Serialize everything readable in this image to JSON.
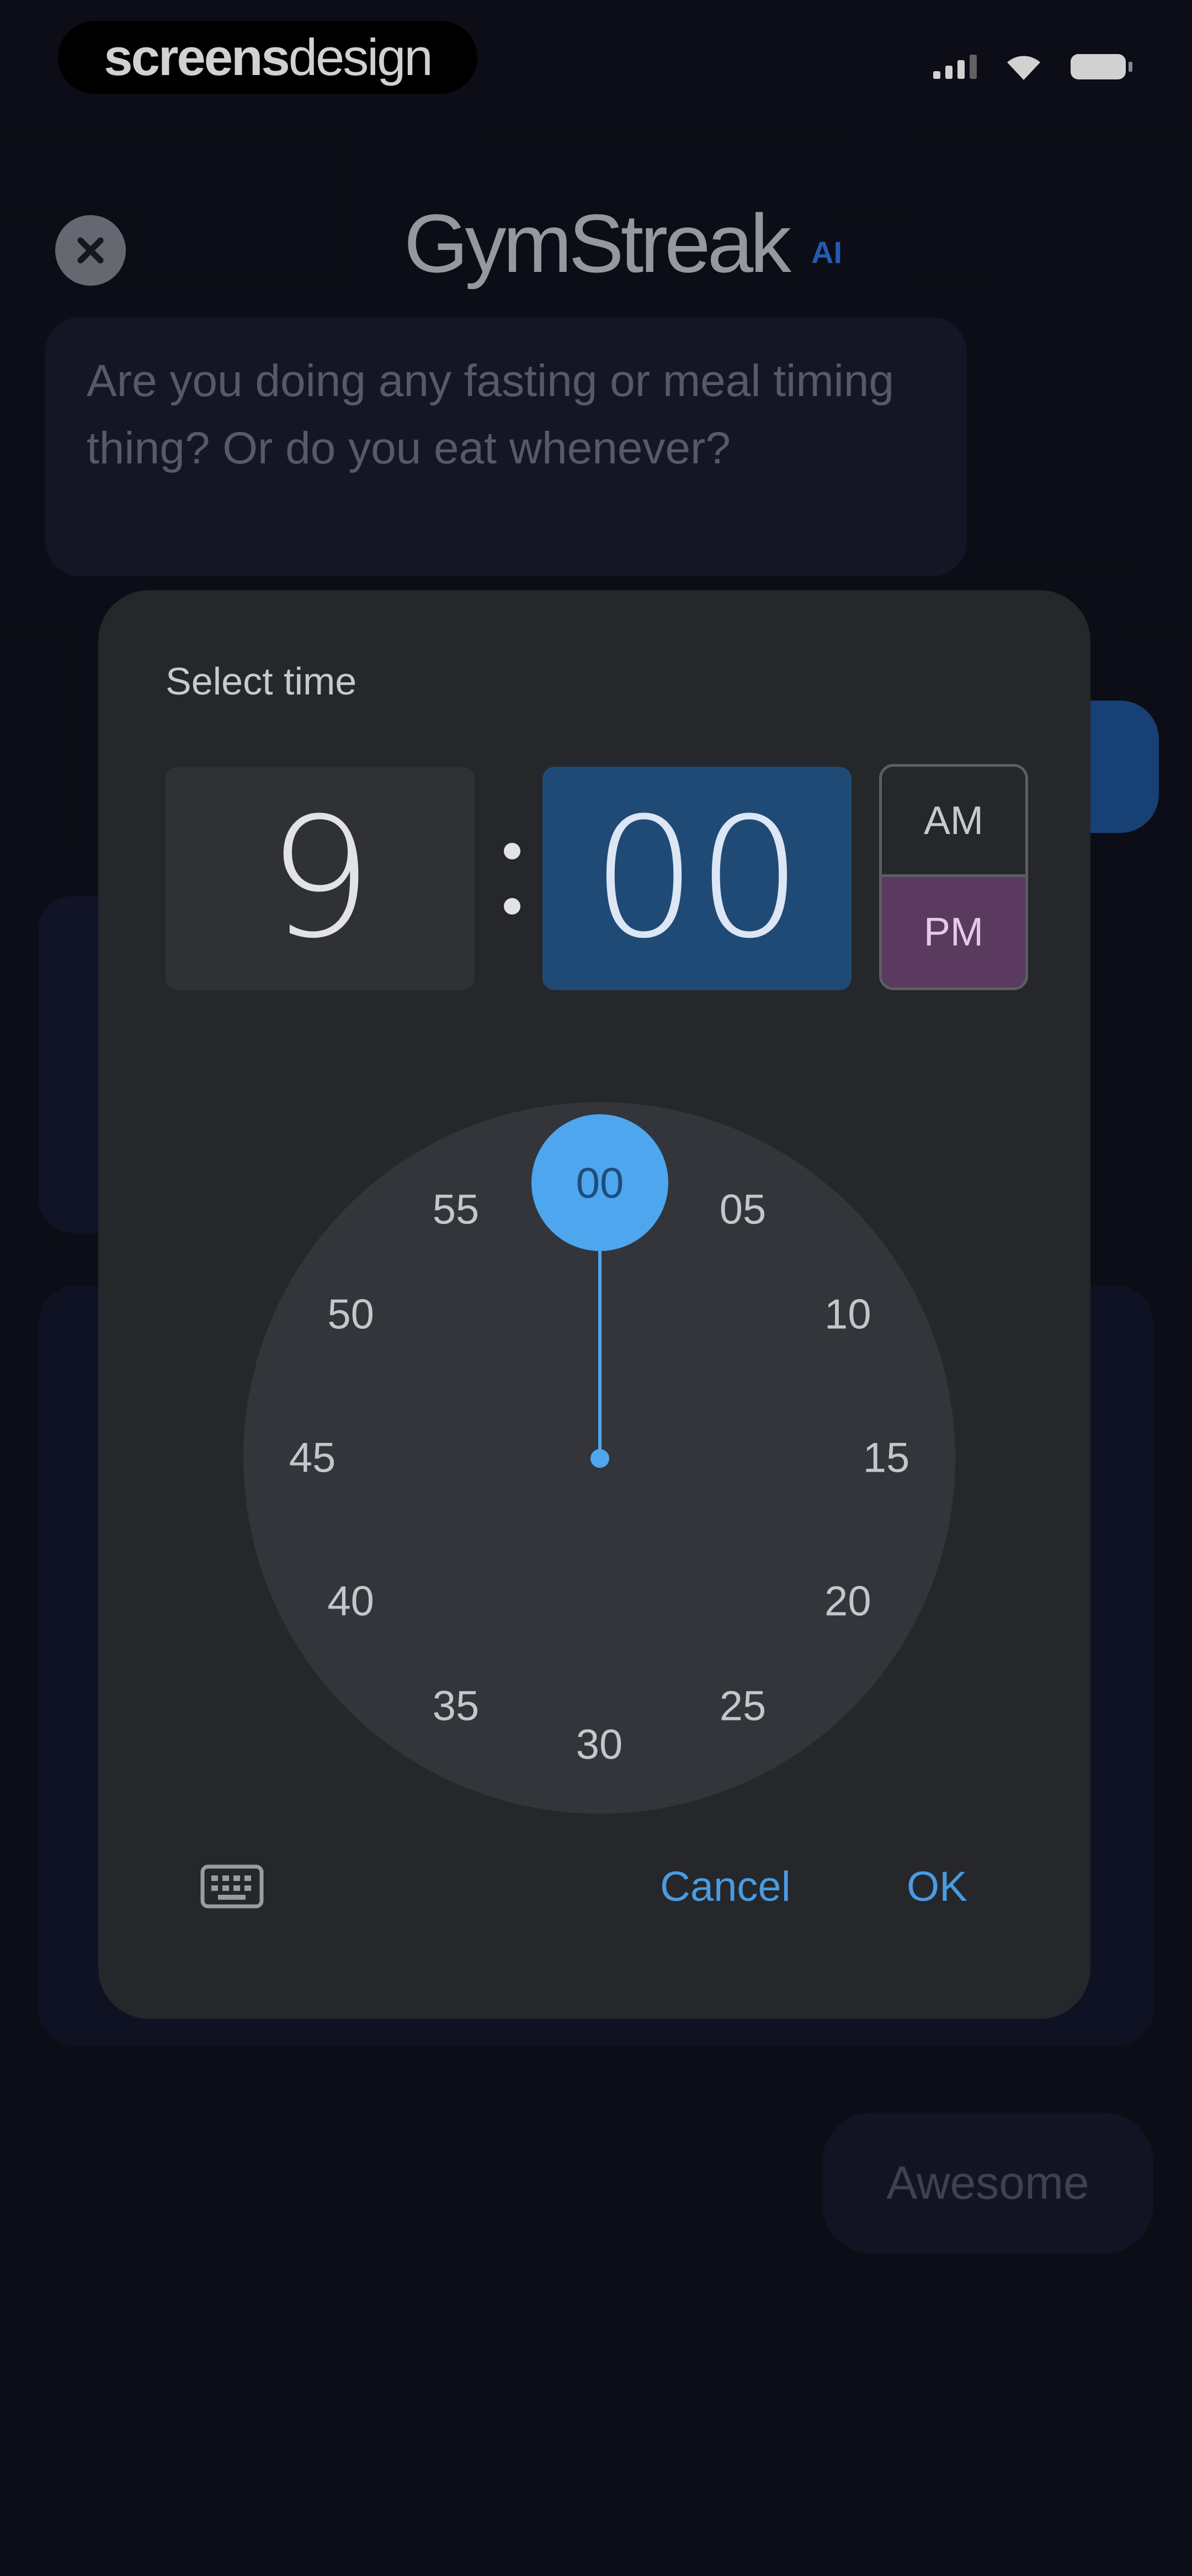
{
  "status_bar": {
    "brand_bold": "screens",
    "brand_light": "design"
  },
  "header": {
    "logo": "GymStreak",
    "badge": "AI"
  },
  "chat": {
    "question": "Are you doing any fasting or meal timing thing? Or do you eat whenever?",
    "reply_option": "Awesome"
  },
  "time_picker": {
    "title": "Select time",
    "hour": "9",
    "minute": "00",
    "am_label": "AM",
    "pm_label": "PM",
    "selected_period": "PM",
    "dial_labels": [
      "00",
      "05",
      "10",
      "15",
      "20",
      "25",
      "30",
      "35",
      "40",
      "45",
      "50",
      "55"
    ],
    "selected_minute_label": "00",
    "cancel_label": "Cancel",
    "ok_label": "OK"
  },
  "colors": {
    "accent": "#4ea6ef",
    "dialog_bg": "#25272b",
    "pm_selected": "#5a3a5e",
    "minute_box": "#1f4a76"
  }
}
